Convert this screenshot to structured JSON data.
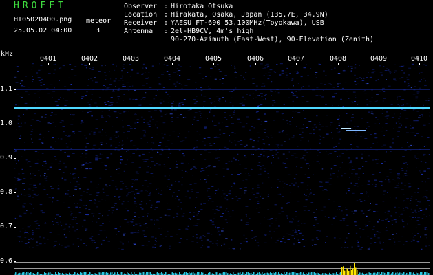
{
  "header": {
    "app_title": "HROFFT",
    "filename": "HI05020400.png",
    "datetime": "25.05.02 04:00",
    "meteor_label": "meteor",
    "meteor_count": "3"
  },
  "info": {
    "observer": {
      "key": "Observer",
      "value": "Hirotaka Otsuka"
    },
    "location": {
      "key": "Location",
      "value": "Hirakata, Osaka, Japan (135.7E, 34.9N)"
    },
    "receiver": {
      "key": "Receiver",
      "value": "YAESU FT-690 53.100MHz(Toyokawa), USB"
    },
    "antenna": {
      "key": "Antenna",
      "value": "2el-HB9CV, 4m's high"
    },
    "antenna2": {
      "value": "90-270-Azimuth (East-West), 90-Elevation (Zenith)"
    }
  },
  "axes": {
    "y_unit": "kHz",
    "y_ticks": [
      "1.1",
      "1.0",
      "0.9",
      "0.8",
      "0.7",
      "0.6"
    ],
    "x_ticks": [
      "0401",
      "0402",
      "0403",
      "0404",
      "0405",
      "0406",
      "0407",
      "0408",
      "0409",
      "0410"
    ]
  },
  "colors": {
    "background": "#000000",
    "title_green": "#3fdc3f",
    "carrier_line": "#4fd8ff",
    "noise_blue": "#1a2fb0",
    "meteor_echo": "#bfe8ff",
    "activity_bars": "#29c6e0",
    "activity_peak": "#ffe600"
  }
}
